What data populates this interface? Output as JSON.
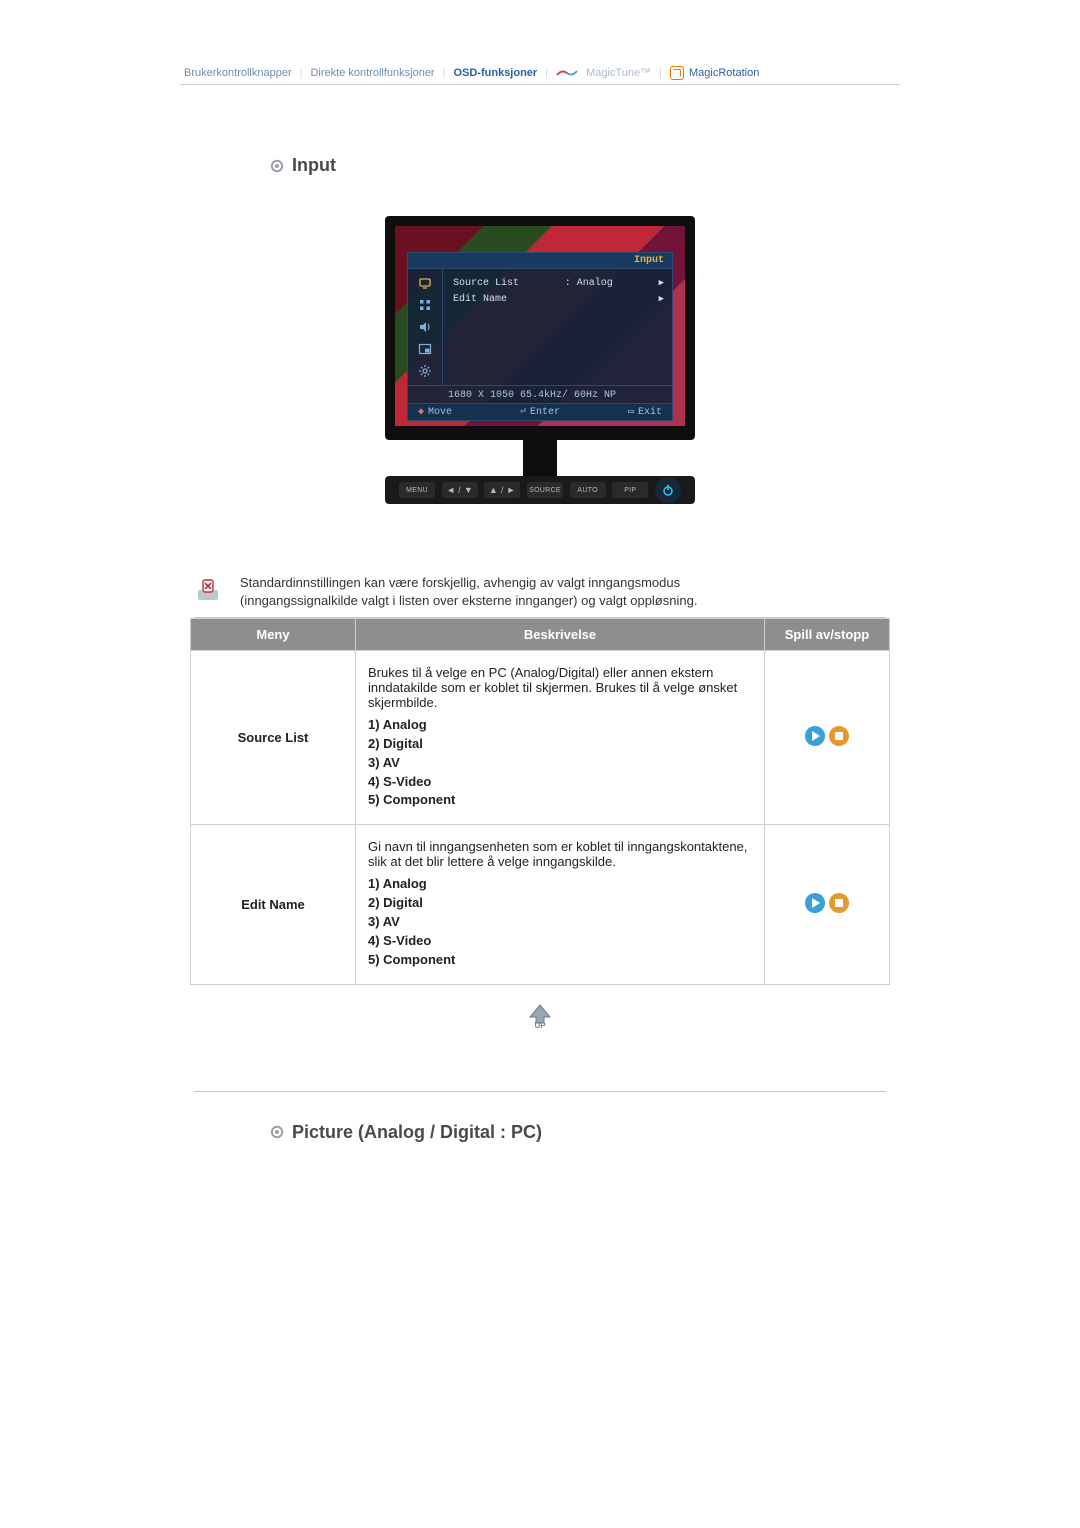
{
  "tabs": {
    "t1": "Brukerkontrollknapper",
    "t2": "Direkte kontrollfunksjoner",
    "t3": "OSD-funksjoner",
    "t4": "MagicTune™",
    "t5": "MagicRotation"
  },
  "section1_title": "Input",
  "osd": {
    "title": "Input",
    "row1_label": "Source List",
    "row1_value": ": Analog",
    "row2_label": "Edit Name",
    "resolution": "1680 X 1050  65.4kHz/  60Hz  NP",
    "foot_move": "Move",
    "foot_enter": "Enter",
    "foot_exit": "Exit"
  },
  "monitor_buttons": {
    "b1": "MENU",
    "b2": "◄ / ▼",
    "b3": "▲ / ►",
    "b4": "SOURCE",
    "b5": "AUTO",
    "b6": "PIP"
  },
  "note_text_line1": "Standardinnstillingen kan være forskjellig, avhengig av valgt inngangsmodus",
  "note_text_line2": "(inngangssignalkilde valgt i listen over eksterne innganger) og valgt oppløsning.",
  "table": {
    "h1": "Meny",
    "h2": "Beskrivelse",
    "h3": "Spill av/stopp",
    "rows": [
      {
        "name": "Source List",
        "intro": "Brukes til å velge en PC (Analog/Digital) eller annen ekstern inndatakilde som er koblet til skjermen. Brukes til å velge ønsket skjermbilde.",
        "opts": "1) Analog\n2) Digital\n3) AV\n4) S-Video\n5) Component"
      },
      {
        "name": "Edit Name",
        "intro": "Gi navn til inngangsenheten som er koblet til inngangskontaktene, slik at det blir lettere å velge inngangskilde.",
        "opts": "1) Analog\n2) Digital\n3) AV\n4) S-Video\n5) Component"
      }
    ]
  },
  "section2_title": "Picture (Analog / Digital : PC)"
}
